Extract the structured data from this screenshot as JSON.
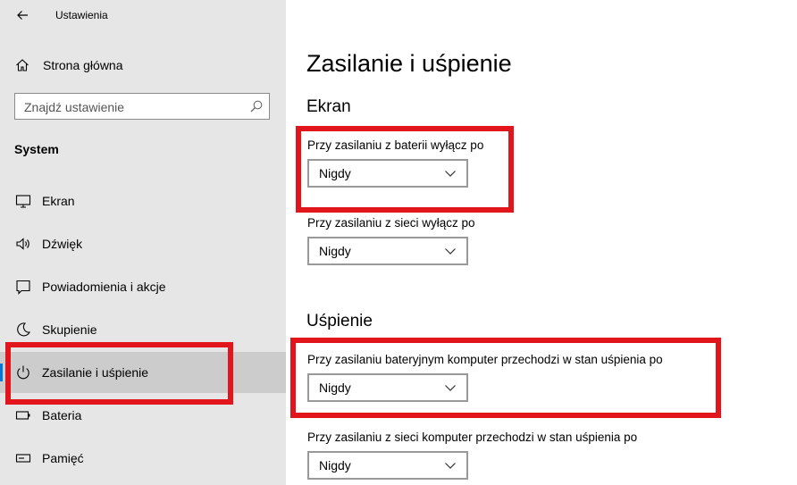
{
  "window": {
    "title": "Ustawienia"
  },
  "sidebar": {
    "home_label": "Strona główna",
    "search_placeholder": "Znajdź ustawienie",
    "section_label": "System",
    "items": [
      {
        "label": "Ekran",
        "icon": "monitor-icon"
      },
      {
        "label": "Dźwięk",
        "icon": "speaker-icon"
      },
      {
        "label": "Powiadomienia i akcje",
        "icon": "notification-icon"
      },
      {
        "label": "Skupienie",
        "icon": "moon-icon"
      },
      {
        "label": "Zasilanie i uśpienie",
        "icon": "power-icon",
        "selected": true
      },
      {
        "label": "Bateria",
        "icon": "battery-icon"
      },
      {
        "label": "Pamięć",
        "icon": "storage-icon"
      }
    ]
  },
  "main": {
    "title": "Zasilanie i uśpienie",
    "screen": {
      "title": "Ekran",
      "battery_label": "Przy zasilaniu z baterii wyłącz po",
      "battery_value": "Nigdy",
      "ac_label": "Przy zasilaniu z sieci wyłącz po",
      "ac_value": "Nigdy"
    },
    "sleep": {
      "title": "Uśpienie",
      "battery_label": "Przy zasilaniu bateryjnym komputer przechodzi w stan uśpienia po",
      "battery_value": "Nigdy",
      "ac_label": "Przy zasilaniu z sieci komputer przechodzi w stan uśpienia po",
      "ac_value": "Nigdy"
    }
  },
  "colors": {
    "highlight": "#e2151d",
    "accent": "#0078d7",
    "sidebar_bg": "#e6e6e6"
  }
}
